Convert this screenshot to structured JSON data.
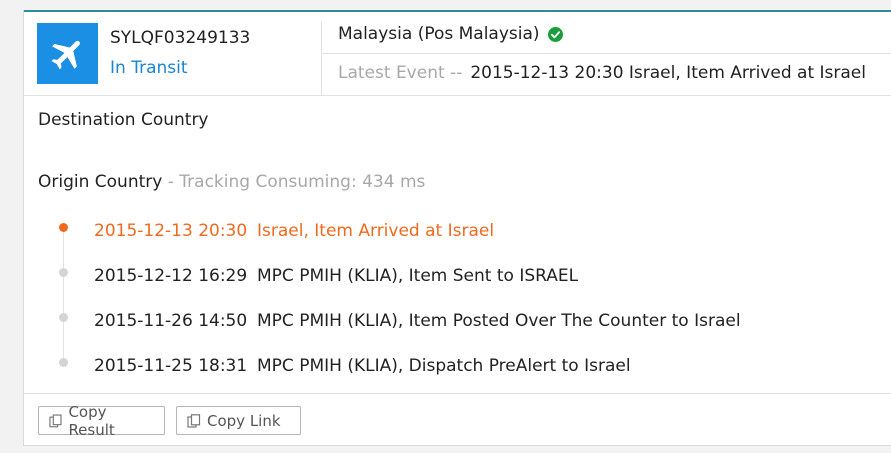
{
  "header": {
    "tracking_number": "SYLQF03249133",
    "status": "In Transit",
    "carrier": "Malaysia (Pos Malaysia)",
    "latest_label": "Latest Event --",
    "latest_text": "2015-12-13 20:30 Israel, Item Arrived at Israel",
    "plane_icon": "airplane-icon",
    "verified_icon": "check-circle-icon",
    "accent_color": "#1a8fe3",
    "verified_color": "#1a9e3c"
  },
  "destination": {
    "label": "Destination Country"
  },
  "origin": {
    "label": "Origin Country",
    "consuming": " - Tracking Consuming: 434 ms"
  },
  "events": [
    {
      "time": "2015-12-13 20:30",
      "desc": "Israel, Item Arrived at Israel",
      "active": true
    },
    {
      "time": "2015-12-12 16:29",
      "desc": "MPC PMIH (KLIA), Item Sent to ISRAEL",
      "active": false
    },
    {
      "time": "2015-11-26 14:50",
      "desc": "MPC PMIH (KLIA), Item Posted Over The Counter to Israel",
      "active": false
    },
    {
      "time": "2015-11-25 18:31",
      "desc": "MPC PMIH (KLIA), Dispatch PreAlert to Israel",
      "active": false
    }
  ],
  "footer": {
    "copy_result": "Copy Result",
    "copy_link": "Copy Link",
    "copy_icon": "copy-icon"
  },
  "colors": {
    "active_event": "#ef6a1e",
    "link": "#1a86d0"
  }
}
